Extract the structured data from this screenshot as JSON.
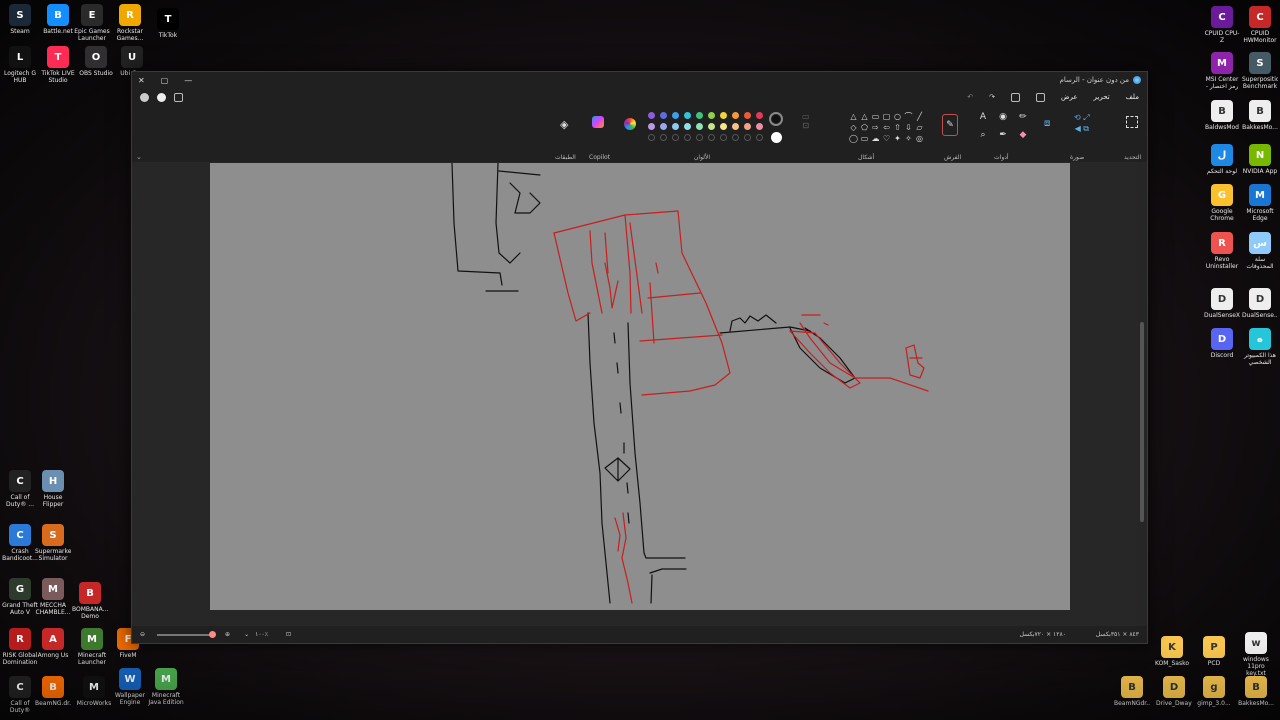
{
  "desktop": {
    "top_left_icons": [
      {
        "label": "Steam",
        "icon": "steam-icon",
        "color": "#1b2838"
      },
      {
        "label": "Battle.net",
        "icon": "battlenet-icon",
        "color": "#148eff"
      },
      {
        "label": "Epic Games Launcher",
        "icon": "epic-icon",
        "color": "#2a2a2a"
      },
      {
        "label": "Rockstar Games...",
        "icon": "rockstar-icon",
        "color": "#f0a800"
      },
      {
        "label": "TikTok",
        "icon": "tiktok-icon",
        "color": "#000000"
      },
      {
        "label": "Logitech G HUB",
        "icon": "logitech-icon",
        "color": "#111111"
      },
      {
        "label": "TikTok LIVE Studio",
        "icon": "tiktok-live-icon",
        "color": "#fe2c55"
      },
      {
        "label": "OBS Studio",
        "icon": "obs-icon",
        "color": "#302e31"
      },
      {
        "label": "Ubi Con",
        "icon": "ubisoft-icon",
        "color": "#222222"
      }
    ],
    "left_bottom_icons": [
      {
        "label": "Call of Duty® ...",
        "icon": "cod-icon",
        "color": "#222222"
      },
      {
        "label": "House Flipper",
        "icon": "house-flipper-icon",
        "color": "#6a8fb0"
      },
      {
        "label": "Crash Bandicoot...",
        "icon": "crash-icon",
        "color": "#2b7ad8"
      },
      {
        "label": "Supermarket Simulator",
        "icon": "supermarket-icon",
        "color": "#d96b1e"
      },
      {
        "label": "Grand Theft Auto V",
        "icon": "gta-icon",
        "color": "#2d3b2d"
      },
      {
        "label": "MECCHA CHAMBLE...",
        "icon": "meccha-icon",
        "color": "#7a5a5a"
      },
      {
        "label": "BOMBANA... Demo",
        "icon": "bombana-icon",
        "color": "#c62828"
      },
      {
        "label": "RISK Global Domination",
        "icon": "risk-icon",
        "color": "#b71c1c"
      },
      {
        "label": "Among Us",
        "icon": "among-us-icon",
        "color": "#c62828"
      },
      {
        "label": "Minecraft Launcher",
        "icon": "minecraft-icon",
        "color": "#3e7a2e"
      },
      {
        "label": "FiveM",
        "icon": "fivem-icon",
        "color": "#ef6c00"
      },
      {
        "label": "Call of Duty®",
        "icon": "cod-icon",
        "color": "#222222"
      },
      {
        "label": "BeamNG.dr...",
        "icon": "beamng-icon",
        "color": "#ff6d00"
      },
      {
        "label": "MicroWorks",
        "icon": "microworks-icon",
        "color": "#111111"
      },
      {
        "label": "Wallpaper Engine",
        "icon": "wallpaper-engine-icon",
        "color": "#1565c0"
      },
      {
        "label": "Minecraft Java Edition",
        "icon": "minecraft-java-icon",
        "color": "#4caf50"
      }
    ],
    "right_icons": [
      {
        "label": "CPUID CPU-Z",
        "icon": "cpuz-icon",
        "color": "#6a1b9a"
      },
      {
        "label": "CPUID HWMonitor",
        "icon": "hwmonitor-icon",
        "color": "#c62828"
      },
      {
        "label": "MSI Center - رمز اختصار",
        "icon": "msi-center-icon",
        "color": "#8e24aa"
      },
      {
        "label": "Superposition Benchmark",
        "icon": "superposition-icon",
        "color": "#455a64"
      },
      {
        "label": "BaldwsMod",
        "icon": "bakkes-icon",
        "color": "#eeeeee"
      },
      {
        "label": "BakkesMo...",
        "icon": "bakkes-icon",
        "color": "#eeeeee"
      },
      {
        "label": "لوحة التحكم",
        "icon": "control-panel-icon",
        "color": "#1e88e5"
      },
      {
        "label": "NVIDIA App",
        "icon": "nvidia-icon",
        "color": "#76b900"
      },
      {
        "label": "Google Chrome",
        "icon": "chrome-icon",
        "color": "#fbc02d"
      },
      {
        "label": "Microsoft Edge",
        "icon": "edge-icon",
        "color": "#1976d2"
      },
      {
        "label": "Revo Uninstaller",
        "icon": "revo-icon",
        "color": "#ef5350"
      },
      {
        "label": "سلة المحذوفات",
        "icon": "recycle-bin-icon",
        "color": "#90caf9"
      },
      {
        "label": "DualSenseX",
        "icon": "dualsense-icon",
        "color": "#eeeeee"
      },
      {
        "label": "DualSense...",
        "icon": "dualsense-icon",
        "color": "#eeeeee"
      },
      {
        "label": "Discord",
        "icon": "discord-icon",
        "color": "#5865f2"
      },
      {
        "label": "هذا الكمبيوتر الشخصي",
        "icon": "this-pc-icon",
        "color": "#26c6da"
      }
    ],
    "bottom_right_icons": [
      {
        "label": "KOM_Sasko",
        "icon": "folder-icon",
        "color": "#f9c74f"
      },
      {
        "label": "PCD",
        "icon": "folder-icon",
        "color": "#f9c74f"
      },
      {
        "label": "windows 11pro key.txt",
        "icon": "text-file-icon",
        "color": "#eeeeee"
      },
      {
        "label": "BeamNGdr...",
        "icon": "folder-icon",
        "color": "#f9c74f"
      },
      {
        "label": "Drive_Dwayne",
        "icon": "folder-icon",
        "color": "#f9c74f"
      },
      {
        "label": "gimp_3.0...",
        "icon": "folder-icon",
        "color": "#f9c74f"
      },
      {
        "label": "BakkesMo...",
        "icon": "folder-icon",
        "color": "#f9c74f"
      }
    ]
  },
  "paint": {
    "title": "من دون عنوان - الرسام",
    "menus": [
      "ملف",
      "تحرير",
      "عرض"
    ],
    "ribbon_labels": {
      "layers": "الطبقات",
      "copilot": "Copilot",
      "colors": "الألوان",
      "shapes": "أشكال",
      "brushes": "الفرش",
      "tools": "أدوات",
      "image": "صورة",
      "selection": "التحديد"
    },
    "colors": {
      "row1": [
        "#8e5cd9",
        "#5b6ee1",
        "#3aa0e8",
        "#38c0d8",
        "#3cc47c",
        "#8cd24a",
        "#f2d43a",
        "#f49a3a",
        "#e85a3a",
        "#e23a5a"
      ],
      "row2": [
        "#b89ae6",
        "#9aa6ee",
        "#8ccaf2",
        "#8ee0ea",
        "#8ee2b4",
        "#c2e68e",
        "#f6e58c",
        "#f6c08a",
        "#f2a08c",
        "#f08ca4"
      ],
      "active_primary": "#111111",
      "active_secondary": "#ffffff",
      "accent": "#e23a5a"
    },
    "status": {
      "zoom": "١٠٠٪",
      "canvas_size": "١٢٨٠ × ٧٢٠بكسل",
      "position": "٨٤٣ × ٣٥١بكسل"
    }
  }
}
